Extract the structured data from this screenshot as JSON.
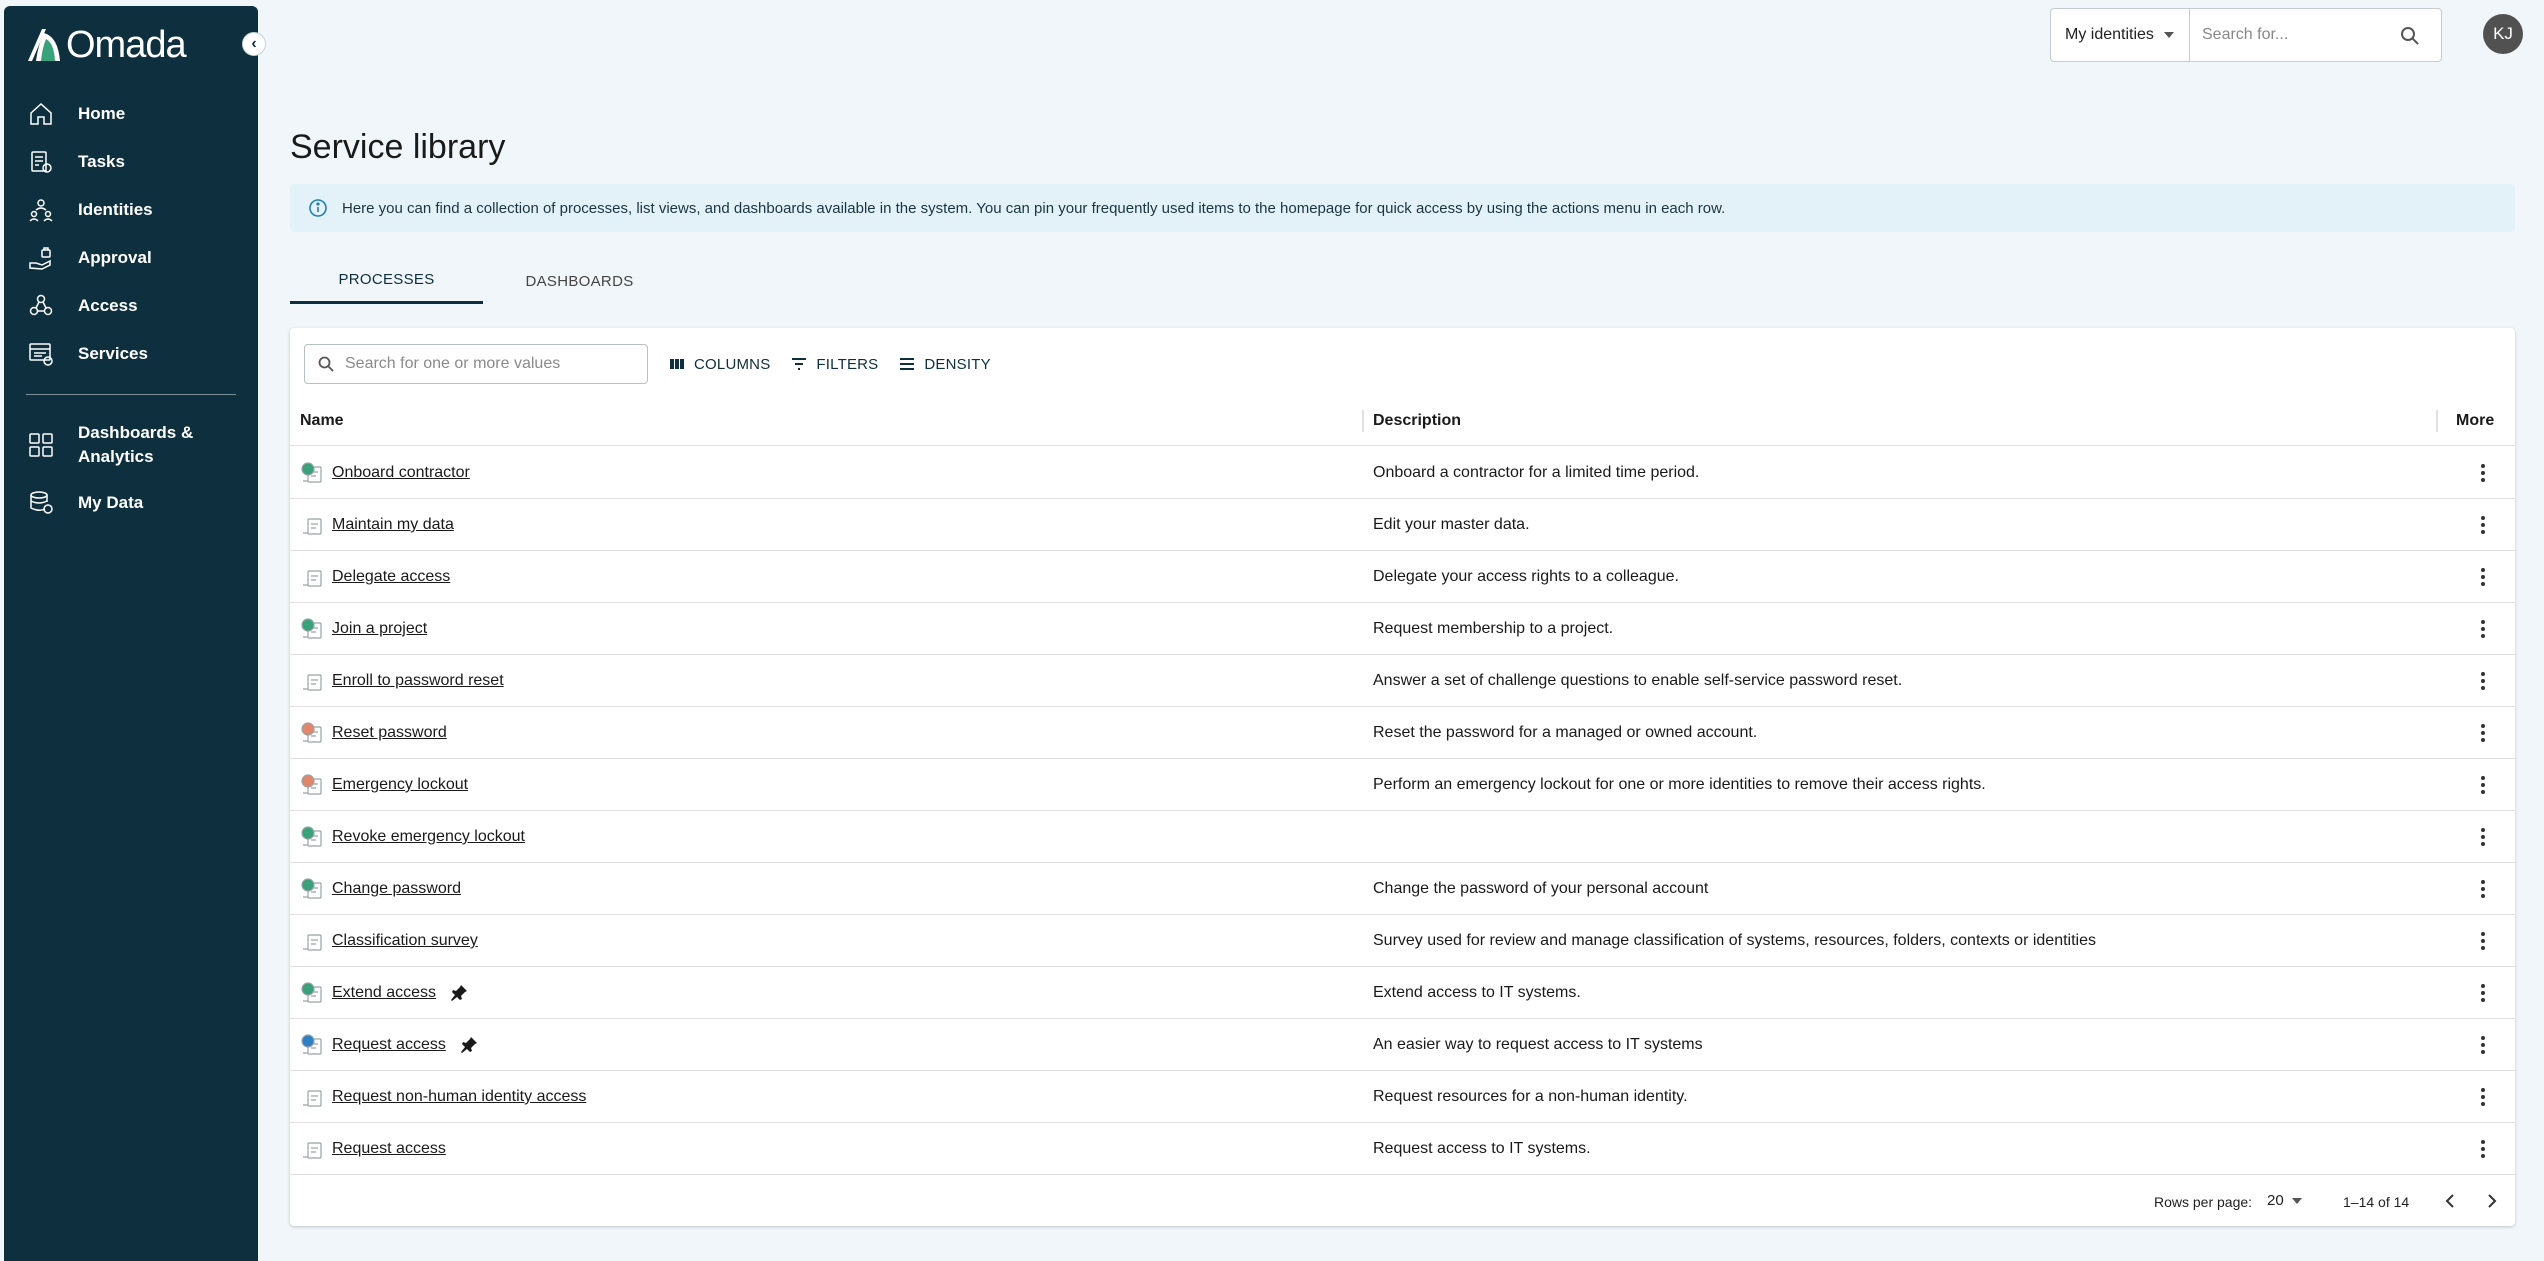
{
  "brand": {
    "name": "Omada"
  },
  "sidebar": {
    "items": [
      {
        "label": "Home",
        "icon": "home-icon"
      },
      {
        "label": "Tasks",
        "icon": "tasks-icon"
      },
      {
        "label": "Identities",
        "icon": "identities-icon"
      },
      {
        "label": "Approval",
        "icon": "approval-icon"
      },
      {
        "label": "Access",
        "icon": "access-icon"
      },
      {
        "label": "Services",
        "icon": "services-icon"
      }
    ],
    "secondary": [
      {
        "label": "Dashboards & Analytics",
        "icon": "dashboards-icon"
      },
      {
        "label": "My Data",
        "icon": "my-data-icon"
      }
    ]
  },
  "topbar": {
    "scope_label": "My identities",
    "search_placeholder": "Search for...",
    "avatar_initials": "KJ"
  },
  "page": {
    "title": "Service library",
    "info": "Here you can find a collection of processes, list views, and dashboards available in the system. You can pin your frequently used items to the homepage for quick access by using the actions menu in each row."
  },
  "tabs": [
    {
      "label": "PROCESSES",
      "active": true
    },
    {
      "label": "DASHBOARDS",
      "active": false
    }
  ],
  "toolbar": {
    "search_placeholder": "Search for one or more values",
    "columns_label": "COLUMNS",
    "filters_label": "FILTERS",
    "density_label": "DENSITY"
  },
  "table": {
    "headers": {
      "name": "Name",
      "description": "Description",
      "more": "More"
    },
    "rows": [
      {
        "name": "Onboard contractor",
        "description": "Onboard a contractor for a limited time period.",
        "badge": "#3aa27a",
        "pinned": false
      },
      {
        "name": "Maintain my data",
        "description": "Edit your master data.",
        "badge": "",
        "pinned": false
      },
      {
        "name": "Delegate access",
        "description": "Delegate your access rights to a colleague.",
        "badge": "",
        "pinned": false
      },
      {
        "name": "Join a project",
        "description": "Request membership to a project.",
        "badge": "#3aa27a",
        "pinned": false
      },
      {
        "name": "Enroll to password reset",
        "description": "Answer a set of challenge questions to enable self-service password reset.",
        "badge": "",
        "pinned": false
      },
      {
        "name": "Reset password",
        "description": "Reset the password for a managed or owned account.",
        "badge": "#e0866a",
        "pinned": false
      },
      {
        "name": "Emergency lockout",
        "description": "Perform an emergency lockout for one or more identities to remove their access rights.",
        "badge": "#e0866a",
        "pinned": false
      },
      {
        "name": "Revoke emergency lockout",
        "description": "",
        "badge": "#3aa27a",
        "pinned": false
      },
      {
        "name": "Change password",
        "description": "Change the password of your personal account",
        "badge": "#3aa27a",
        "pinned": false
      },
      {
        "name": "Classification survey",
        "description": "Survey used for review and manage classification of systems, resources, folders, contexts or identities",
        "badge": "",
        "pinned": false
      },
      {
        "name": "Extend access",
        "description": "Extend access to IT systems.",
        "badge": "#3aa27a",
        "pinned": true
      },
      {
        "name": "Request access",
        "description": "An easier way to request access to IT systems",
        "badge": "#2f7fc4",
        "pinned": true
      },
      {
        "name": "Request non-human identity access",
        "description": "Request resources for a non-human identity.",
        "badge": "",
        "pinned": false
      },
      {
        "name": "Request access",
        "description": "Request access to IT systems.",
        "badge": "",
        "pinned": false
      }
    ]
  },
  "pagination": {
    "rows_per_page_label": "Rows per page:",
    "rows_per_page": "20",
    "range": "1–14 of 14"
  }
}
